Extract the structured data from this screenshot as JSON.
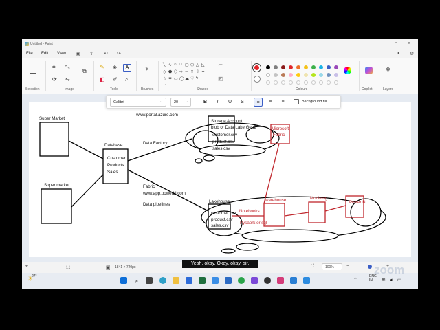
{
  "window": {
    "title": "Untitled - Paint"
  },
  "menu": {
    "file": "File",
    "edit": "Edit",
    "view": "View"
  },
  "ribbon": {
    "groups": {
      "selection": "Selection",
      "image": "Image",
      "tools": "Tools",
      "brushes": "Brushes",
      "shapes": "Shapes",
      "colours": "Colours",
      "copilot": "Copilot",
      "layers": "Layers"
    },
    "colours": [
      "#000000",
      "#7f7f7f",
      "#8b1a1a",
      "#e0262b",
      "#ee6f2a",
      "#f4c21a",
      "#3db14a",
      "#1ab3e6",
      "#3b5ec6",
      "#9a48b9",
      "#ffffff",
      "#c3c3c3",
      "#b97a57",
      "#ffaec9",
      "#ffc90e",
      "#efe4b0",
      "#b5e61d",
      "#99d9ea",
      "#7092be",
      "#c8bfe7"
    ],
    "accent_color": "#e0262b"
  },
  "text_toolbar": {
    "font": "Calibri",
    "size": "20",
    "background_fill": "Background fill"
  },
  "diagram": {
    "super_market_1": "Super Market",
    "super_market_2": "Super market",
    "database_label": "Database",
    "database_lines": [
      "Customer",
      "Products",
      "Sales"
    ],
    "azure": "Azure",
    "azure_url": "www.portal.azure.com",
    "data_factory": "Data Factory",
    "fabric": "Fabric",
    "fabric_url": "www.app.powerbi.com",
    "data_pipelines": "Data pipelines",
    "storage_lines": [
      "Storage Account",
      "blob or Data Lake Gen2",
      "customer.csv",
      "product.csv",
      "sales.csv"
    ],
    "microsoft_fabric": [
      "Microsoft",
      "Fabric"
    ],
    "lakehouse": "Lakehouse",
    "lakehouse_files": [
      "customer.csv",
      "product.csv",
      "sales.csv"
    ],
    "notebooks": "Notebooks",
    "pyspark": "Pysaprk or sql",
    "warehouse": "warehouse",
    "modeling": "Modleing",
    "powerbi": "Power BI"
  },
  "statusbar": {
    "canvas_size": "1841 × 720px",
    "zoom": "100%"
  },
  "taskbar": {
    "weather": "27°",
    "lang_line1": "ENG",
    "lang_line2": "IN"
  },
  "caption": "Yeah, okay. Okay, okay, sir.",
  "watermark": "zoom"
}
